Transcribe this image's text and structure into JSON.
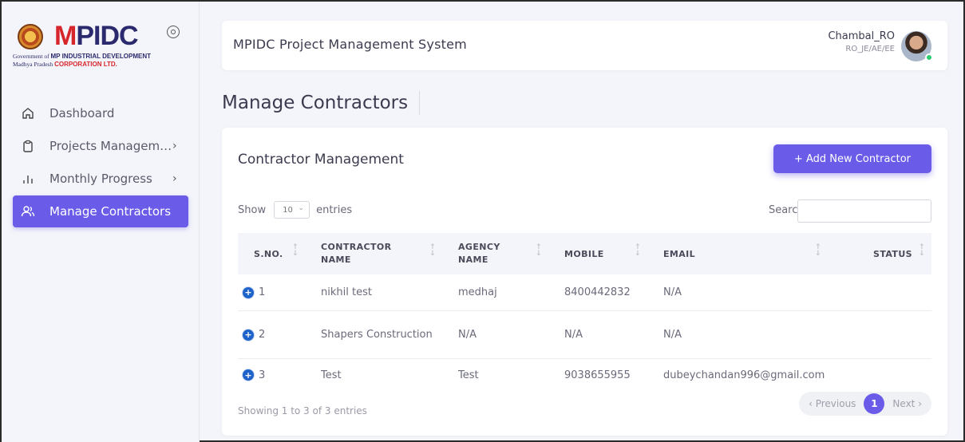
{
  "logo": {
    "mark_prefix": "M",
    "mark_rest": "PIDC",
    "line1_small": "Government of",
    "line1_bold": "MP INDUSTRIAL DEVELOPMENT",
    "line2_small": "Madhya Pradesh",
    "line2_bold": "CORPORATION LTD."
  },
  "sidebar": {
    "items": [
      {
        "label": "Dashboard",
        "icon": "home-icon",
        "chevron": ""
      },
      {
        "label": "Projects Managem…",
        "icon": "clipboard-icon",
        "chevron": "›"
      },
      {
        "label": "Monthly Progress",
        "icon": "bar-chart-icon",
        "chevron": "›"
      },
      {
        "label": "Manage Contractors",
        "icon": "users-icon",
        "chevron": "",
        "active": true
      }
    ]
  },
  "header": {
    "title": "MPIDC Project Management System",
    "user_name": "Chambal_RO",
    "user_role": "RO_JE/AE/EE"
  },
  "page": {
    "title": "Manage Contractors"
  },
  "card": {
    "title": "Contractor Management",
    "add_button": "+ Add New Contractor",
    "show_label": "Show",
    "entries_value": "10",
    "entries_label": "entries",
    "search_label": "Search:",
    "search_value": ""
  },
  "table": {
    "headers": [
      "S.NO.",
      "CONTRACTOR NAME",
      "AGENCY NAME",
      "MOBILE",
      "EMAIL",
      "STATUS"
    ],
    "rows": [
      {
        "sno": "1",
        "contractor": "nikhil test",
        "agency": "medhaj",
        "mobile": "8400442832",
        "email": "N/A",
        "status": ""
      },
      {
        "sno": "2",
        "contractor": "Shapers Construction",
        "agency": "N/A",
        "mobile": "N/A",
        "email": "N/A",
        "status": ""
      },
      {
        "sno": "3",
        "contractor": "Test",
        "agency": "Test",
        "mobile": "9038655955",
        "email": "dubeychandan996@gmail.com",
        "status": ""
      }
    ]
  },
  "footer": {
    "info": "Showing 1 to 3 of 3 entries",
    "prev": "‹ Previous",
    "current_page": "1",
    "next": "Next ›"
  },
  "colors": {
    "accent": "#6a5ce8",
    "expand_button": "#1e63c9",
    "online": "#2ecc71"
  }
}
